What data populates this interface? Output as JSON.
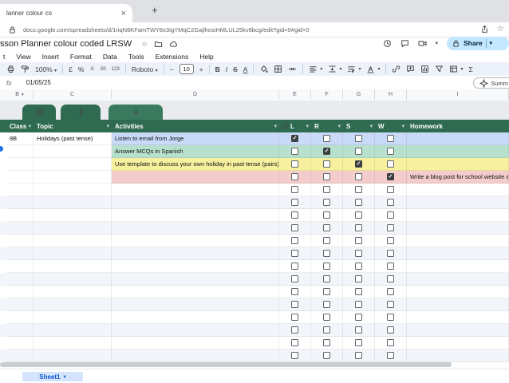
{
  "browser": {
    "tab_title": "lanner colour co",
    "close_tab": "×",
    "new_tab": "+",
    "url": "docs.google.com/spreadsheets/d/1riqN8KFamTWY8x3IgYMqC2GajlhosiHMLUL25kv6bcg/edit?gid=0#gid=0"
  },
  "header": {
    "doc_title": "sson Planner colour coded LRSW",
    "menus": [
      "t",
      "View",
      "Insert",
      "Format",
      "Data",
      "Tools",
      "Extensions",
      "Help"
    ],
    "share_label": "Share"
  },
  "toolbar": {
    "zoom": "100%",
    "currency": "£",
    "percent": "%",
    "dec0": ".0",
    "dec00": ".00",
    "fmt123": "123",
    "font": "Roboto",
    "size": "10",
    "minus": "−",
    "plus": "+",
    "bold": "B",
    "italic": "I",
    "strike": "S",
    "textcolor": "A",
    "sigma": "Σ"
  },
  "formula": {
    "fx": "fx",
    "value": "01/05/25",
    "summarize": "Summ"
  },
  "grid": {
    "column_letters": [
      "B",
      "C",
      "D",
      "E",
      "F",
      "G",
      "H",
      "I"
    ]
  },
  "table": {
    "headers": [
      "Class",
      "Topic",
      "Activities",
      "L",
      "R",
      "S",
      "W",
      "Homework"
    ],
    "header_color": "#2e6b50",
    "rows": [
      {
        "class": "8B",
        "topic": "Holidays (past tense)",
        "activity": "Listen to email from Jorge",
        "homework": "",
        "color": "#c9daf8",
        "checks": [
          true,
          false,
          false,
          false
        ]
      },
      {
        "class": "",
        "topic": "",
        "activity": "Answer MCQs in Spanish",
        "homework": "",
        "color": "#b7e1cd",
        "checks": [
          false,
          true,
          false,
          false
        ]
      },
      {
        "class": "",
        "topic": "",
        "activity": "Use template to discuss your own holiday in past tense (pairs)",
        "homework": "",
        "color": "#f7f09e",
        "checks": [
          false,
          false,
          true,
          false
        ]
      },
      {
        "class": "",
        "topic": "",
        "activity": "",
        "homework": "Write a blog post for school website ab",
        "color": "#f4cccc",
        "checks": [
          false,
          false,
          false,
          true
        ]
      }
    ],
    "empty_rows": 14
  },
  "footer": {
    "sheet_tab": "Sheet1"
  },
  "colors": {
    "accent_blue": "#1a73e8",
    "share_bg": "#c2e7ff",
    "share_text": "#001d35",
    "sheet_tab_bg": "#d4e4fc",
    "sheet_tab_text": "#0b57d0",
    "banding": "#f2f5f9",
    "checkbox_checked": "#3c4043"
  }
}
